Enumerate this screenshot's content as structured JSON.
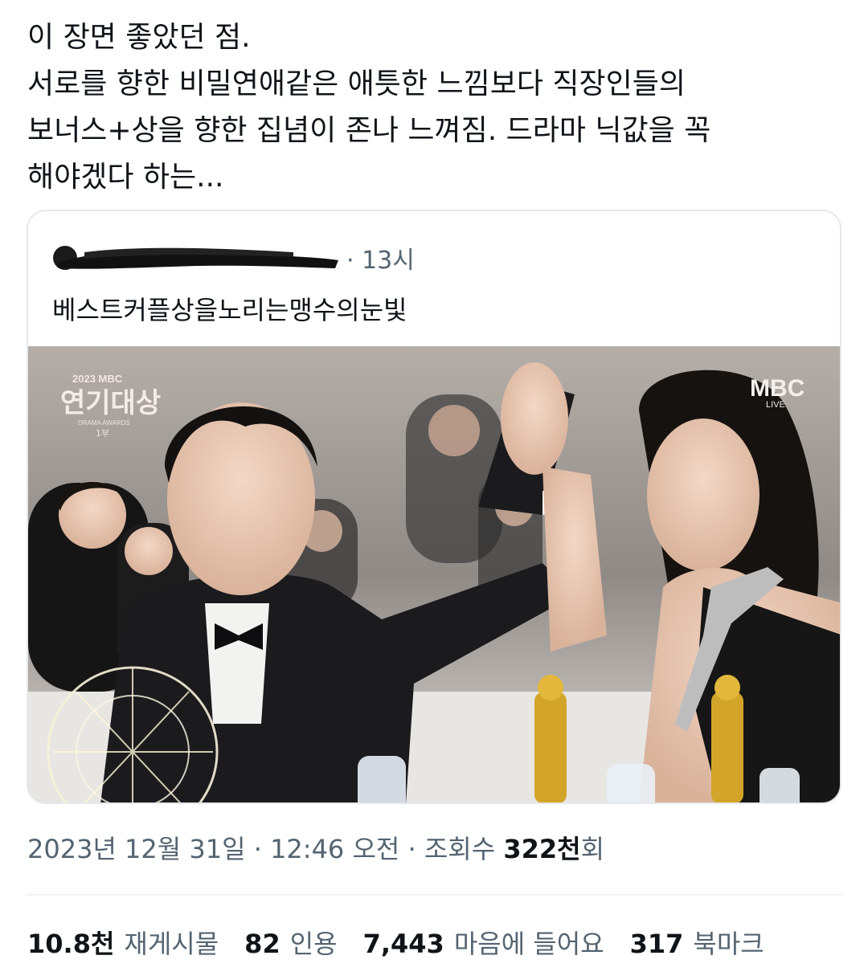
{
  "tweet": {
    "lines": [
      "이 장면 좋았던 점.",
      "서로를 향한 비밀연애같은 애틋한 느낌보다 직장인들의",
      "보너스+상을 향한 집념이 존나 느껴짐. 드라마 닉값을 꼭",
      "해야겠다 하는..."
    ]
  },
  "quote": {
    "time": "· 13시",
    "text": "베스트커플상을노리는맹수의눈빛",
    "media": {
      "logo_year": "2023 MBC",
      "logo_title": "연기대상",
      "logo_sub": "DRAMA AWARDS",
      "logo_part": "1부",
      "broadcaster": "MBC",
      "broadcaster_sub": "LIVE"
    }
  },
  "meta": {
    "date": "2023년 12월 31일",
    "sep1": " · ",
    "time": "12:46 오전",
    "sep2": " · ",
    "views_label": "조회수 ",
    "views_value": "322천",
    "views_suffix": "회"
  },
  "stats": [
    {
      "value": "10.8천",
      "label": "재게시물"
    },
    {
      "value": "82",
      "label": "인용"
    },
    {
      "value": "7,443",
      "label": "마음에 들어요"
    },
    {
      "value": "317",
      "label": "북마크"
    }
  ],
  "colors": {
    "text_primary": "#0f1419",
    "text_secondary": "#536471",
    "border": "#e6e9eb"
  }
}
